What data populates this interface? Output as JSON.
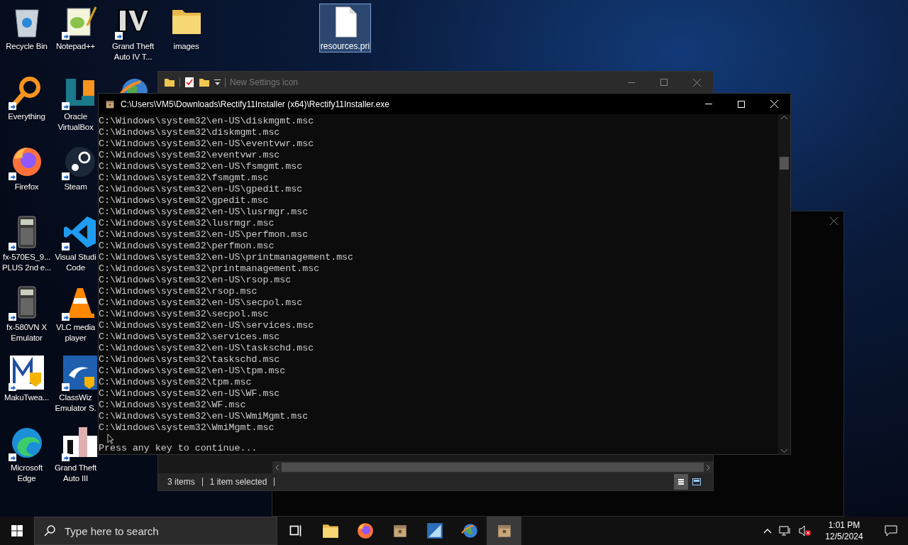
{
  "desktop": {
    "columns": [
      [
        {
          "label": "Recycle Bin",
          "kind": "recycle-bin",
          "shortcut": false
        },
        {
          "label": "Everything",
          "kind": "everything",
          "shortcut": true
        },
        {
          "label": "Firefox",
          "kind": "firefox",
          "shortcut": true
        },
        {
          "label": "fx-570ES_9...\nPLUS 2nd e...",
          "kind": "calculator",
          "shortcut": true
        },
        {
          "label": "fx-580VN X\nEmulator",
          "kind": "calculator",
          "shortcut": true
        },
        {
          "label": "MakuTwea...",
          "kind": "maku",
          "shortcut": true
        },
        {
          "label": "Microsoft\nEdge",
          "kind": "edge",
          "shortcut": true
        }
      ],
      [
        {
          "label": "Notepad++",
          "kind": "notepad",
          "shortcut": true
        },
        {
          "label": "Oracle\nVirtualBox",
          "kind": "virtualbox",
          "shortcut": true
        },
        {
          "label": "Steam",
          "kind": "steam",
          "shortcut": true
        },
        {
          "label": "Visual Studi\nCode",
          "kind": "vscode",
          "shortcut": true
        },
        {
          "label": "VLC media\nplayer",
          "kind": "vlc",
          "shortcut": true
        },
        {
          "label": "ClassWiz\nEmulator S.",
          "kind": "classwiz",
          "shortcut": true
        },
        {
          "label": "Grand Theft\nAuto III",
          "kind": "gta3",
          "shortcut": true
        }
      ],
      [
        {
          "label": "Grand Theft\nAuto IV T...",
          "kind": "gta4",
          "shortcut": true
        },
        {
          "kind": "globe"
        }
      ],
      [
        {
          "label": "images",
          "kind": "folder",
          "shortcut": false
        }
      ]
    ],
    "file": {
      "label": "resources.pri",
      "kind": "file",
      "selected": true
    }
  },
  "explorer": {
    "title": "New Settings icon",
    "status": [
      "3 items",
      "1 item selected"
    ]
  },
  "console": {
    "title": "C:\\Users\\VM5\\Downloads\\Rectify11Installer (x64)\\Rectify11Installer.exe",
    "lines": [
      "C:\\Windows\\system32\\en-US\\diskmgmt.msc",
      "C:\\Windows\\system32\\diskmgmt.msc",
      "C:\\Windows\\system32\\en-US\\eventvwr.msc",
      "C:\\Windows\\system32\\eventvwr.msc",
      "C:\\Windows\\system32\\en-US\\fsmgmt.msc",
      "C:\\Windows\\system32\\fsmgmt.msc",
      "C:\\Windows\\system32\\en-US\\gpedit.msc",
      "C:\\Windows\\system32\\gpedit.msc",
      "C:\\Windows\\system32\\en-US\\lusrmgr.msc",
      "C:\\Windows\\system32\\lusrmgr.msc",
      "C:\\Windows\\system32\\en-US\\perfmon.msc",
      "C:\\Windows\\system32\\perfmon.msc",
      "C:\\Windows\\system32\\en-US\\printmanagement.msc",
      "C:\\Windows\\system32\\printmanagement.msc",
      "C:\\Windows\\system32\\en-US\\rsop.msc",
      "C:\\Windows\\system32\\rsop.msc",
      "C:\\Windows\\system32\\en-US\\secpol.msc",
      "C:\\Windows\\system32\\secpol.msc",
      "C:\\Windows\\system32\\en-US\\services.msc",
      "C:\\Windows\\system32\\services.msc",
      "C:\\Windows\\system32\\en-US\\taskschd.msc",
      "C:\\Windows\\system32\\taskschd.msc",
      "C:\\Windows\\system32\\en-US\\tpm.msc",
      "C:\\Windows\\system32\\tpm.msc",
      "C:\\Windows\\system32\\en-US\\WF.msc",
      "C:\\Windows\\system32\\WF.msc",
      "C:\\Windows\\system32\\en-US\\WmiMgmt.msc",
      "C:\\Windows\\system32\\WmiMgmt.msc"
    ],
    "prompt": "Press any key to continue..."
  },
  "taskbar": {
    "search": {
      "placeholder": "Type here to search"
    },
    "apps": [
      {
        "kind": "task-view",
        "selected": false
      },
      {
        "kind": "folder",
        "selected": false
      },
      {
        "kind": "firefox",
        "selected": false
      },
      {
        "kind": "package",
        "selected": false
      },
      {
        "kind": "calc-app",
        "selected": false
      },
      {
        "kind": "globe",
        "selected": false
      },
      {
        "kind": "package",
        "selected": true
      }
    ],
    "time": "1:01 PM",
    "date": "12/5/2024"
  }
}
